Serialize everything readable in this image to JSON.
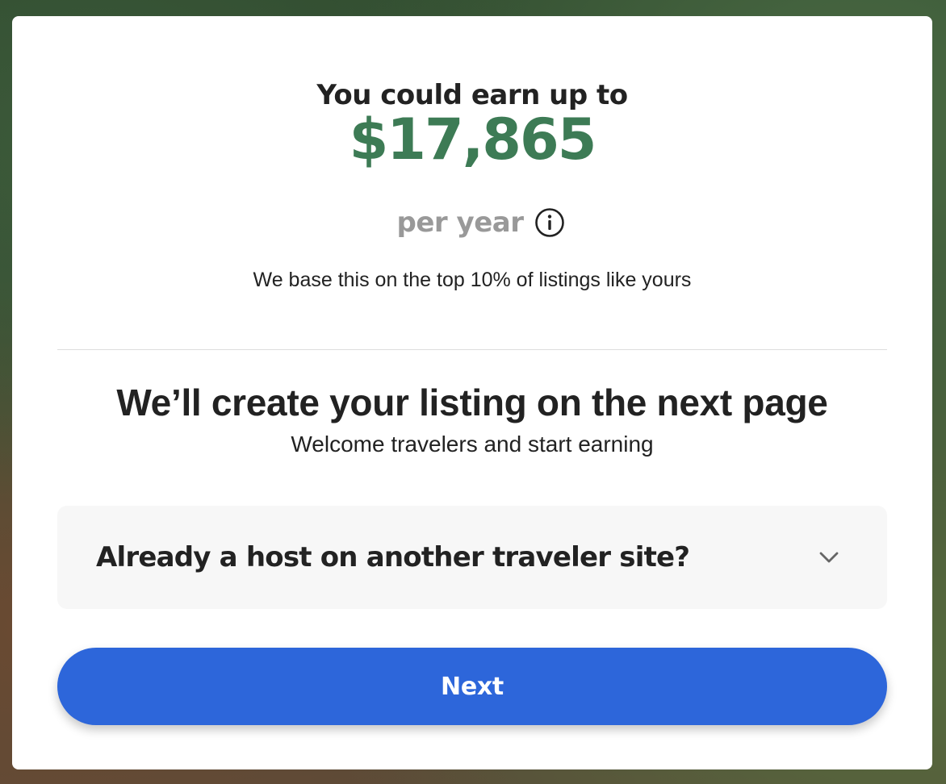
{
  "earnings": {
    "heading": "You could earn up to",
    "amount": "$17,865",
    "period": "per year",
    "info_icon": "info-circle-icon",
    "basis": "We base this on the top 10% of listings like yours"
  },
  "listing": {
    "heading": "We’ll create your listing on the next page",
    "subheading": "Welcome travelers and start earning"
  },
  "accordion": {
    "label": "Already a host on another traveler site?",
    "icon": "chevron-down-icon"
  },
  "actions": {
    "next_label": "Next"
  },
  "colors": {
    "amount": "#3d7b55",
    "primary_button": "#2d66da",
    "muted_text": "#999999",
    "accordion_bg": "#f7f7f7"
  }
}
